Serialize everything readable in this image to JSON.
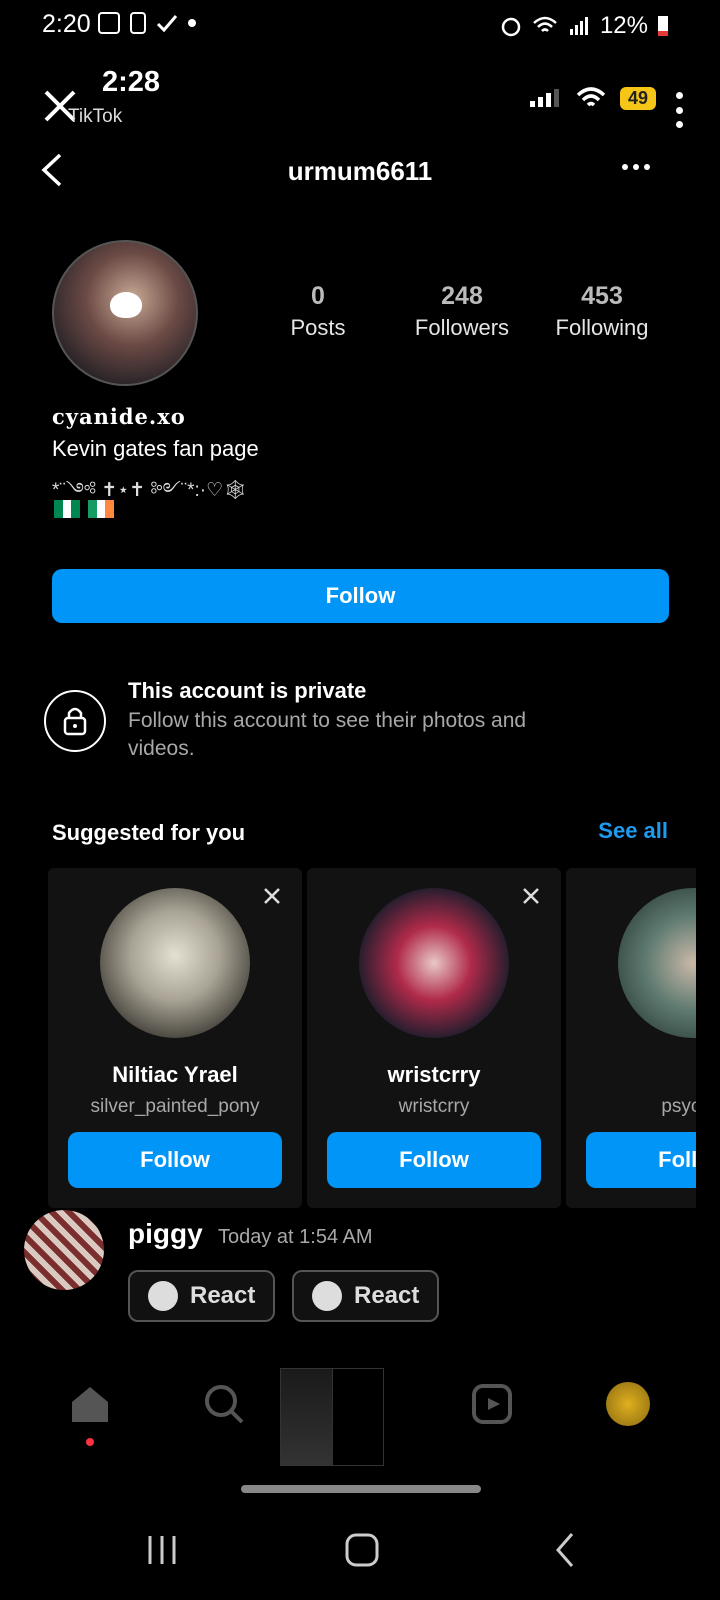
{
  "status_bar": {
    "time": "2:20",
    "battery": "12%"
  },
  "overlay": {
    "time": "2:28",
    "app": "TikTok",
    "badge": "49"
  },
  "header": {
    "username": "urmum6611"
  },
  "profile": {
    "stats": [
      {
        "value": "0",
        "label": "Posts"
      },
      {
        "value": "248",
        "label": "Followers"
      },
      {
        "value": "453",
        "label": "Following"
      }
    ],
    "display_name": "cyanide.xo",
    "bio_line": "Kevin gates fan page",
    "bio_symbols": "*¨༺ ✝⋆✝ ༻¨*:·♡🕸",
    "follow_label": "Follow"
  },
  "private": {
    "title": "This account is private",
    "text": "Follow this account to see their photos and videos."
  },
  "suggested": {
    "title": "Suggested for you",
    "see_all": "See all",
    "cards": [
      {
        "name": "Niltiac Yrael",
        "handle": "silver_painted_pony",
        "button": "Follow"
      },
      {
        "name": "wristcrry",
        "handle": "wristcrry",
        "button": "Follow"
      },
      {
        "name": "",
        "handle": "psychic",
        "button": "Follow"
      }
    ]
  },
  "message": {
    "author": "piggy",
    "time": "Today at 1:54 AM",
    "react1": "React",
    "react2": "React"
  },
  "colors": {
    "accent": "#0095f6",
    "background": "#000000"
  }
}
